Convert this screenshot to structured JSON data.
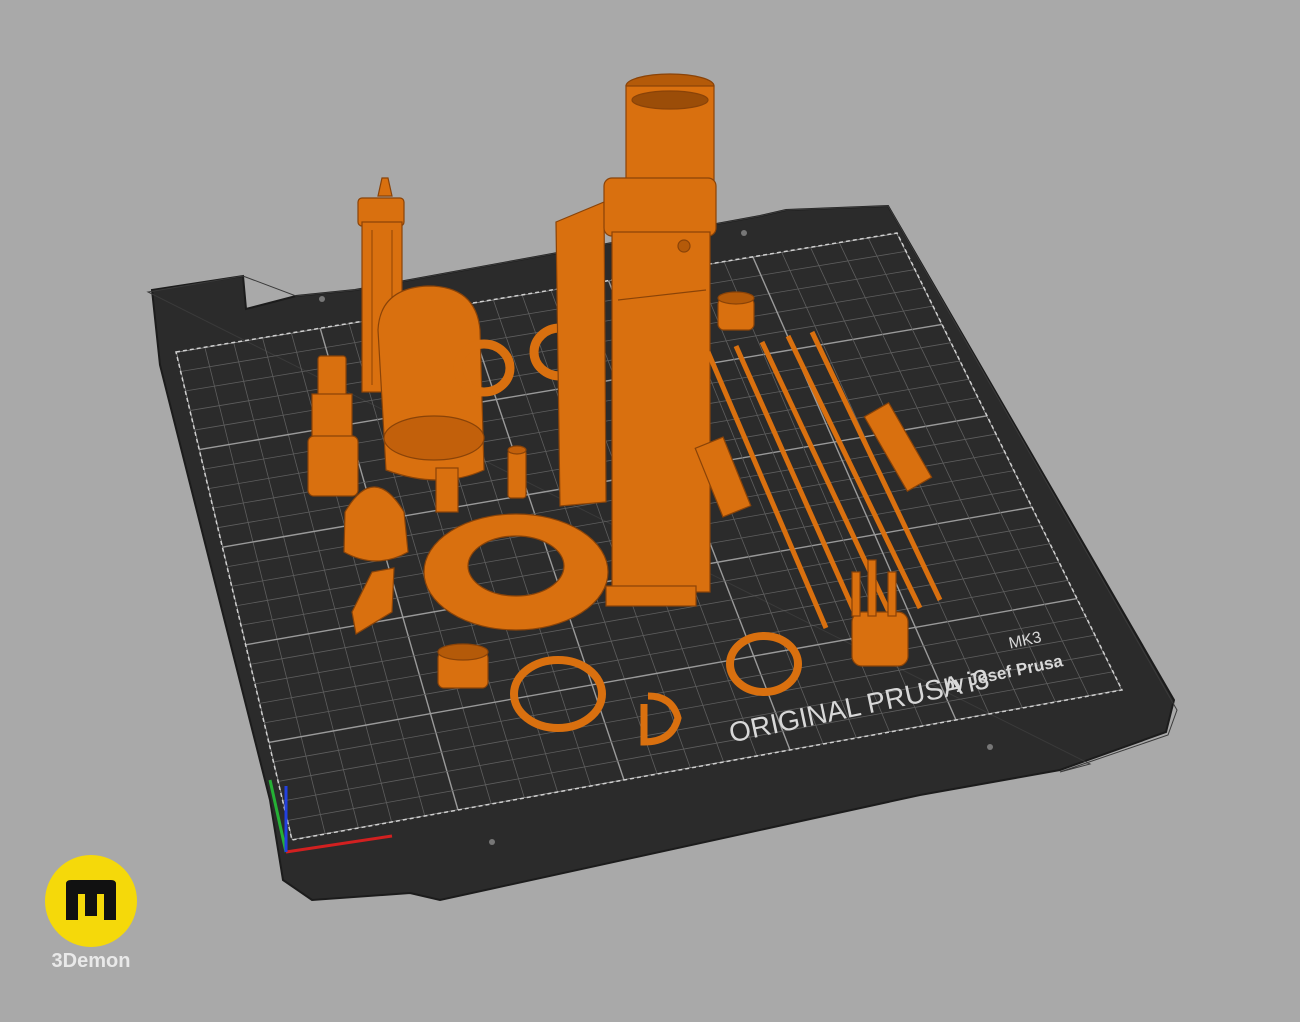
{
  "bed": {
    "brand_line": "ORIGINAL PRUSA i3",
    "model": "MK3",
    "byline": "by Josef Prusa"
  },
  "watermark": {
    "caption": "3Demon",
    "accent": "#f5d90a"
  },
  "colors": {
    "background": "#a9a9a9",
    "bed": "#2b2b2b",
    "grid": "#6e6e6e",
    "part": "#d9700f",
    "axis_x": "#d22020",
    "axis_y": "#25b035",
    "axis_z": "#2240e0"
  },
  "icons": {
    "axes": "xyz-axes-icon",
    "logo": "3demon-logo-icon"
  }
}
